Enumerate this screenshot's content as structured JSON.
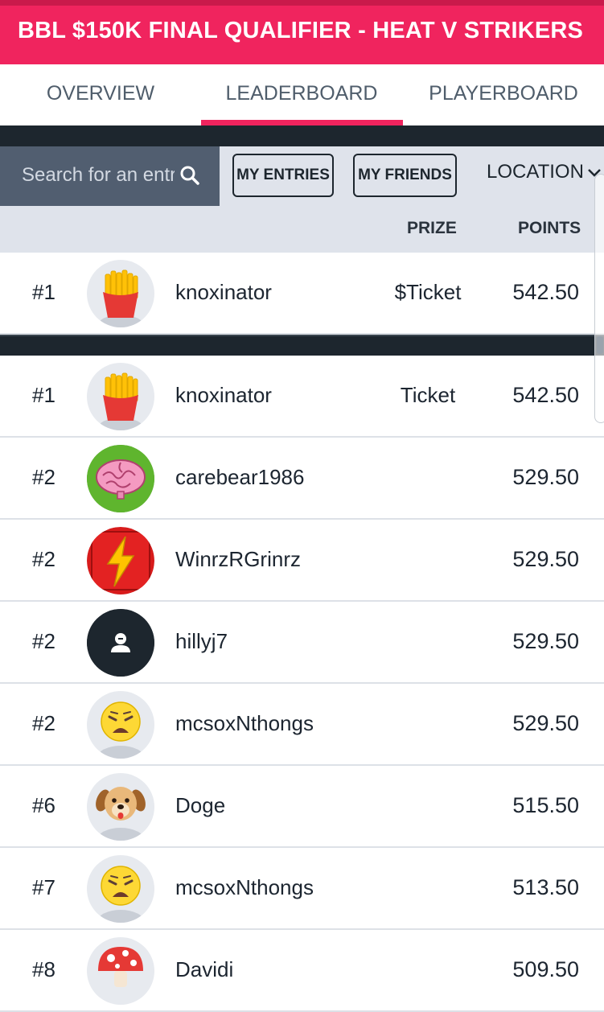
{
  "header": {
    "title": "BBL $150K FINAL QUALIFIER - HEAT V STRIKERS"
  },
  "tabs": [
    {
      "label": "OVERVIEW"
    },
    {
      "label": "LEADERBOARD"
    },
    {
      "label": "PLAYERBOARD"
    }
  ],
  "active_tab": "LEADERBOARD",
  "filters": {
    "search_placeholder": "Search for an entrant",
    "my_entries": "MY ENTRIES",
    "my_friends": "MY FRIENDS",
    "location": "LOCATION"
  },
  "columns": {
    "prize": "PRIZE",
    "points": "POINTS"
  },
  "my_entry": {
    "rank": "#1",
    "name": "knoxinator",
    "prize": "$Ticket",
    "points": "542.50",
    "avatar": "fries-icon"
  },
  "rows": [
    {
      "rank": "#1",
      "name": "knoxinator",
      "prize": "Ticket",
      "points": "542.50",
      "avatar": "fries-icon"
    },
    {
      "rank": "#2",
      "name": "carebear1986",
      "prize": "",
      "points": "529.50",
      "avatar": "brain-icon"
    },
    {
      "rank": "#2",
      "name": "WinrzRGrinrz",
      "prize": "",
      "points": "529.50",
      "avatar": "lightning-icon"
    },
    {
      "rank": "#2",
      "name": "hillyj7",
      "prize": "",
      "points": "529.50",
      "avatar": "default-user-icon"
    },
    {
      "rank": "#2",
      "name": "mcsoxNthongs",
      "prize": "",
      "points": "529.50",
      "avatar": "weary-face-icon"
    },
    {
      "rank": "#6",
      "name": "Doge",
      "prize": "",
      "points": "515.50",
      "avatar": "dog-face-icon"
    },
    {
      "rank": "#7",
      "name": "mcsoxNthongs",
      "prize": "",
      "points": "513.50",
      "avatar": "weary-face-icon"
    },
    {
      "rank": "#8",
      "name": "Davidi",
      "prize": "",
      "points": "509.50",
      "avatar": "mushroom-icon"
    }
  ],
  "colors": {
    "accent": "#f0245e",
    "dark": "#1d262e",
    "search_bg": "#515e70",
    "filter_bg": "#dfe3eb"
  }
}
